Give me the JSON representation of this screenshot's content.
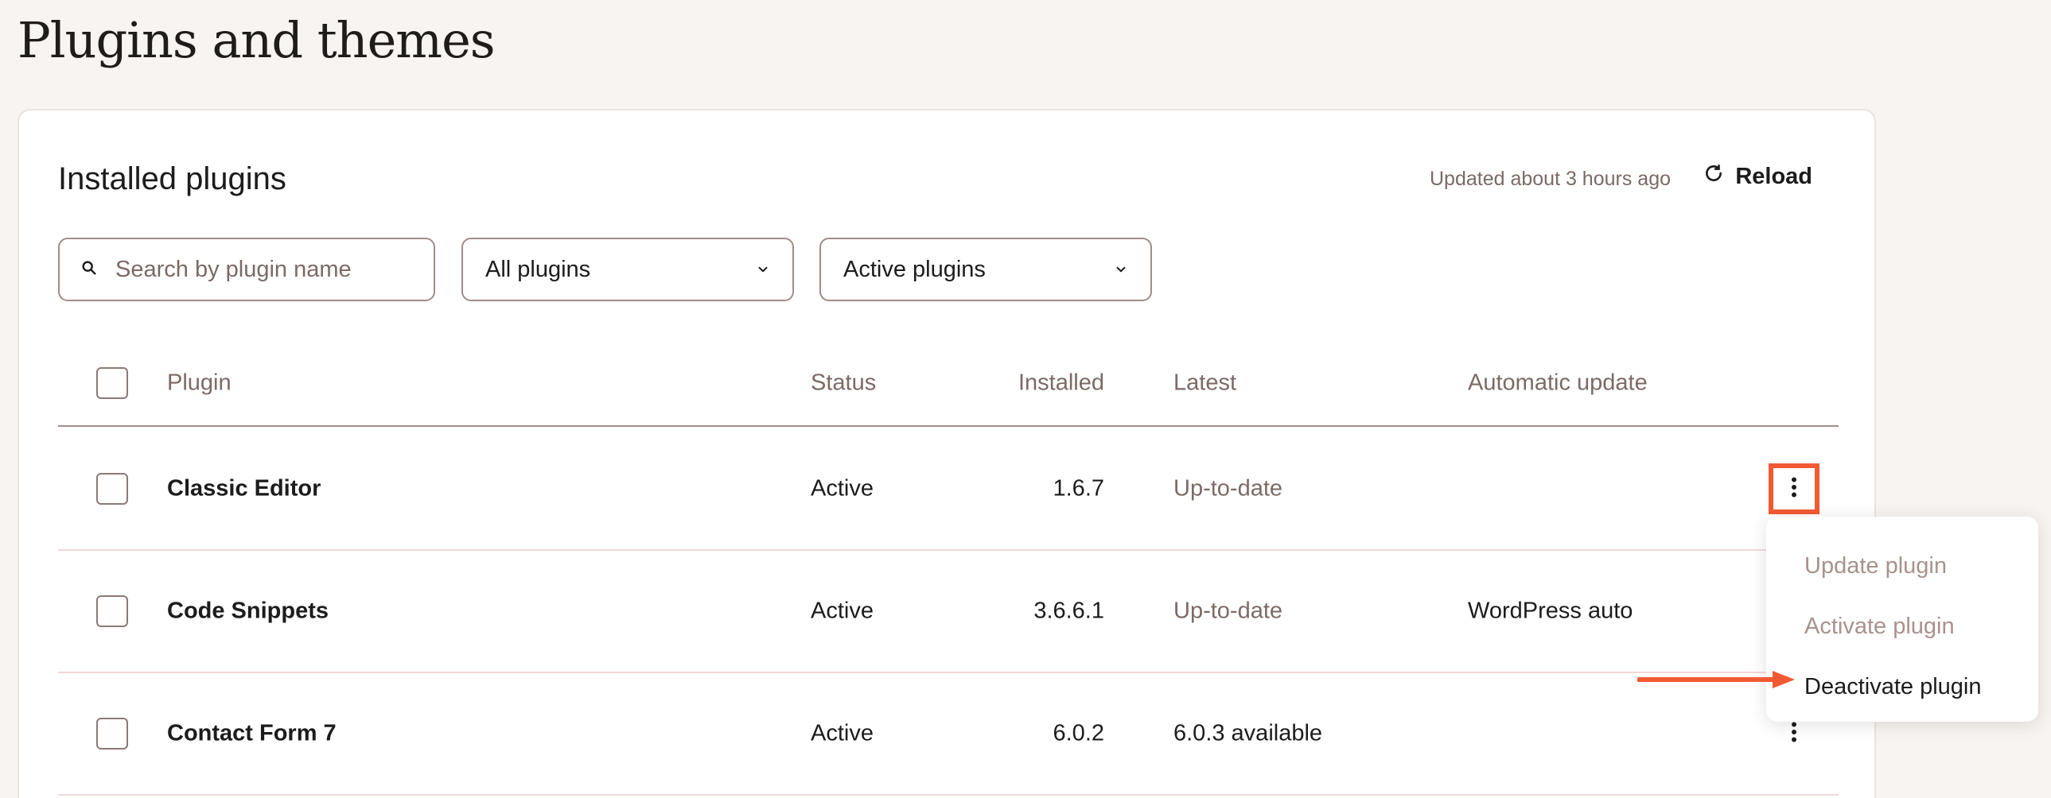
{
  "page": {
    "title": "Plugins and themes"
  },
  "section": {
    "title": "Installed plugins",
    "updated_text": "Updated about 3 hours ago",
    "reload_label": "Reload"
  },
  "filters": {
    "search_placeholder": "Search by plugin name",
    "type_select": "All plugins",
    "status_select": "Active plugins"
  },
  "table": {
    "columns": [
      "Plugin",
      "Status",
      "Installed",
      "Latest",
      "Automatic update"
    ],
    "rows": [
      {
        "plugin": "Classic Editor",
        "status": "Active",
        "installed": "1.6.7",
        "latest": "Up-to-date",
        "auto_update": ""
      },
      {
        "plugin": "Code Snippets",
        "status": "Active",
        "installed": "3.6.6.1",
        "latest": "Up-to-date",
        "auto_update": "WordPress auto"
      },
      {
        "plugin": "Contact Form 7",
        "status": "Active",
        "installed": "6.0.2",
        "latest": "6.0.3 available",
        "auto_update": ""
      }
    ]
  },
  "menu": {
    "items": [
      "Update plugin",
      "Activate plugin",
      "Deactivate plugin"
    ]
  },
  "colors": {
    "accent": "#f25a34",
    "muted_text": "#7b6a66",
    "border": "#a08d88",
    "background": "#f7f4f1"
  },
  "icons": {
    "search": "search-icon",
    "reload": "reload-icon",
    "chevron": "chevron-down-icon",
    "kebab": "more-vertical-icon"
  }
}
